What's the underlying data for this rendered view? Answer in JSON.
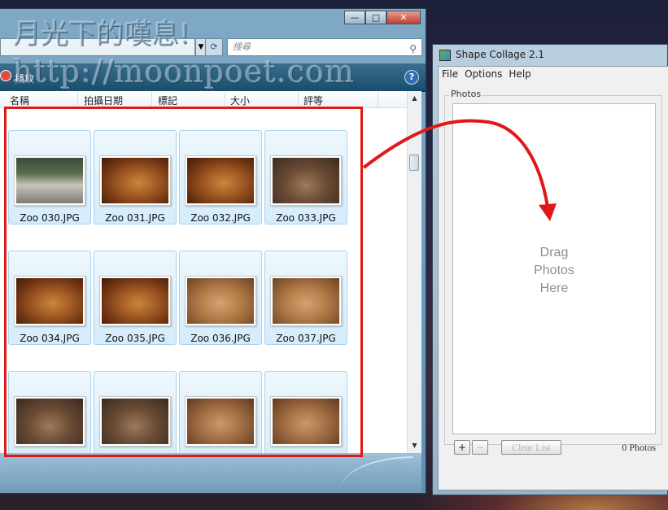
{
  "watermark": {
    "line1": "月光下的嘆息!",
    "line2": "http://moonpoet.com"
  },
  "explorer": {
    "title_buttons": {
      "minimize": "—",
      "maximize": "□",
      "close": "✕"
    },
    "search_placeholder": "搜尋",
    "toolbar_label": "播放",
    "help": "?",
    "columns": [
      "名稱",
      "拍攝日期",
      "標記",
      "大小",
      "評等"
    ],
    "files": [
      {
        "name": "Zoo 030.JPG",
        "scene": "entrance"
      },
      {
        "name": "Zoo 031.JPG",
        "scene": "tortoise"
      },
      {
        "name": "Zoo 032.JPG",
        "scene": "tortoise"
      },
      {
        "name": "Zoo 033.JPG",
        "scene": "lizard-dark"
      },
      {
        "name": "Zoo 034.JPG",
        "scene": "tortoise"
      },
      {
        "name": "Zoo 035.JPG",
        "scene": "tortoise"
      },
      {
        "name": "Zoo 036.JPG",
        "scene": "lizard-light"
      },
      {
        "name": "Zoo 037.JPG",
        "scene": "lizard-light"
      },
      {
        "name": "",
        "scene": "lizard-dark"
      },
      {
        "name": "",
        "scene": "lizard-dark"
      },
      {
        "name": "",
        "scene": "tortoise-pale"
      },
      {
        "name": "",
        "scene": "tortoise-pale"
      }
    ]
  },
  "shape_collage": {
    "title": "Shape Collage 2.1",
    "menu": [
      "File",
      "Options",
      "Help"
    ],
    "photos_group": "Photos",
    "drop_hint": [
      "Drag",
      "Photos",
      "Here"
    ],
    "add_button": "+",
    "remove_button": "−",
    "clear_button": "Clear List",
    "photo_count": "0 Photos"
  },
  "colors": {
    "highlight": "#e01818",
    "arrow": "#e01818",
    "tile_bg": "#dcefff"
  }
}
